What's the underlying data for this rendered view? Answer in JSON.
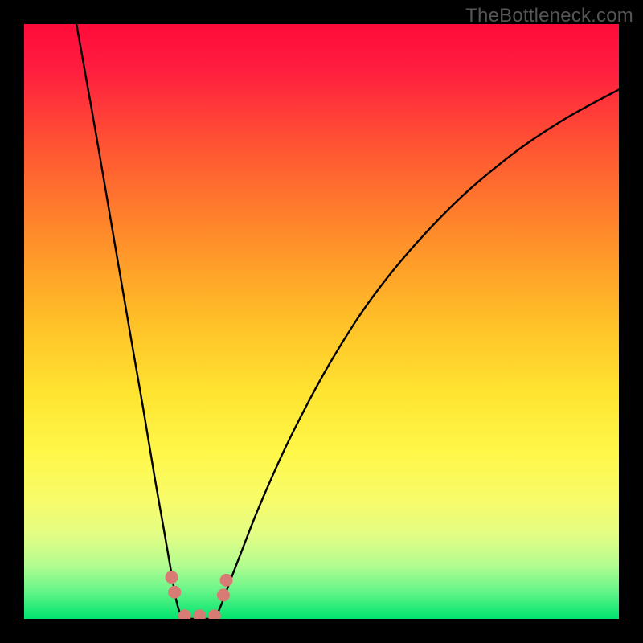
{
  "watermark": "TheBottleneck.com",
  "chart_data": {
    "type": "line",
    "title": "",
    "xlabel": "",
    "ylabel": "",
    "xlim": [
      0,
      100
    ],
    "ylim": [
      0,
      100
    ],
    "series": [
      {
        "name": "curve-left",
        "x": [
          8.8,
          12,
          15,
          18,
          20,
          22,
          23.5,
          24.8,
          25.5,
          26.2,
          27
        ],
        "y": [
          100,
          82,
          64.5,
          47,
          35.5,
          23.5,
          15,
          7.5,
          3.5,
          1,
          0
        ]
      },
      {
        "name": "curve-right",
        "x": [
          32,
          33,
          34.5,
          37,
          40,
          45,
          52,
          60,
          70,
          80,
          90,
          100
        ],
        "y": [
          0,
          2,
          6,
          12.5,
          20,
          31,
          44,
          56,
          67.5,
          76.5,
          83.5,
          89
        ]
      },
      {
        "name": "floor",
        "x": [
          27,
          32
        ],
        "y": [
          0,
          0
        ]
      }
    ],
    "markers": [
      {
        "name": "point-a",
        "x": 24.8,
        "y": 7.0
      },
      {
        "name": "point-b",
        "x": 25.3,
        "y": 4.5
      },
      {
        "name": "point-c",
        "x": 27.0,
        "y": 0.5
      },
      {
        "name": "point-d",
        "x": 29.5,
        "y": 0.5
      },
      {
        "name": "point-e",
        "x": 32.0,
        "y": 0.5
      },
      {
        "name": "point-f",
        "x": 33.5,
        "y": 4.0
      },
      {
        "name": "point-g",
        "x": 34.0,
        "y": 6.5
      }
    ],
    "gradient_stops": [
      {
        "offset": 0.0,
        "color": "#ff0b3a"
      },
      {
        "offset": 0.08,
        "color": "#ff1f3f"
      },
      {
        "offset": 0.2,
        "color": "#ff5233"
      },
      {
        "offset": 0.35,
        "color": "#ff8a2a"
      },
      {
        "offset": 0.5,
        "color": "#ffc028"
      },
      {
        "offset": 0.62,
        "color": "#ffe431"
      },
      {
        "offset": 0.72,
        "color": "#fff749"
      },
      {
        "offset": 0.8,
        "color": "#f8fc6a"
      },
      {
        "offset": 0.86,
        "color": "#e2fd85"
      },
      {
        "offset": 0.91,
        "color": "#b3fc90"
      },
      {
        "offset": 0.95,
        "color": "#6cf68a"
      },
      {
        "offset": 1.0,
        "color": "#00e46e"
      }
    ],
    "curve_color": "#000000",
    "marker_color": "#d77b74",
    "marker_radius": 8
  }
}
